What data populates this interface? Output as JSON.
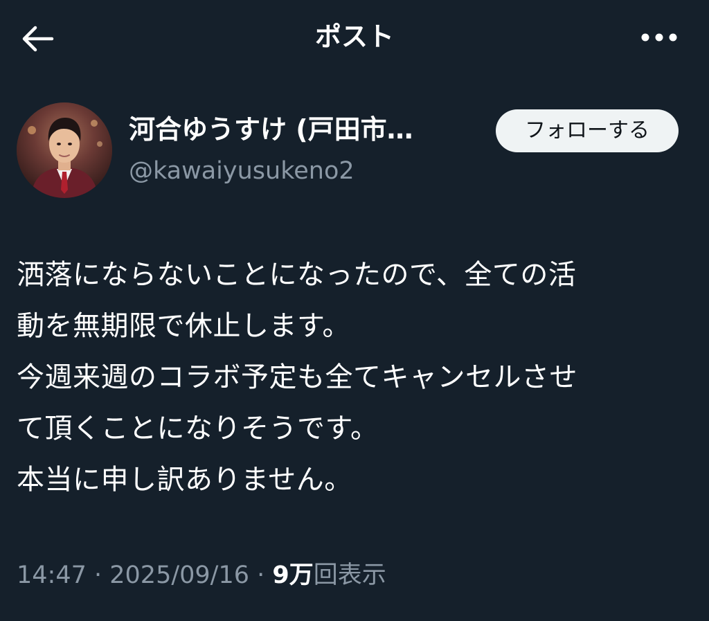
{
  "header": {
    "title": "ポスト",
    "back_icon": "arrow-left-icon",
    "more_icon": "more-horizontal-icon"
  },
  "author": {
    "display_name": "河合ゆうすけ (戸田市…",
    "handle": "@kawaiyusukeno2",
    "follow_label": "フォローする",
    "avatar_icon": "profile-photo"
  },
  "post": {
    "lines": [
      "洒落にならないことになったので、全ての活",
      "動を無期限で休止します。",
      "今週来週のコラボ予定も全てキャンセルさせ",
      "て頂くことになりそうです。",
      "本当に申し訳ありません。"
    ]
  },
  "meta": {
    "time": "14:47",
    "separator": " · ",
    "date": "2025/09/16",
    "views_count": "9万",
    "views_label": "回表示"
  },
  "colors": {
    "background": "#15202b",
    "text_primary": "#ffffff",
    "text_secondary": "#8b98a5",
    "follow_bg": "#eff3f4",
    "follow_text": "#0f1419"
  }
}
